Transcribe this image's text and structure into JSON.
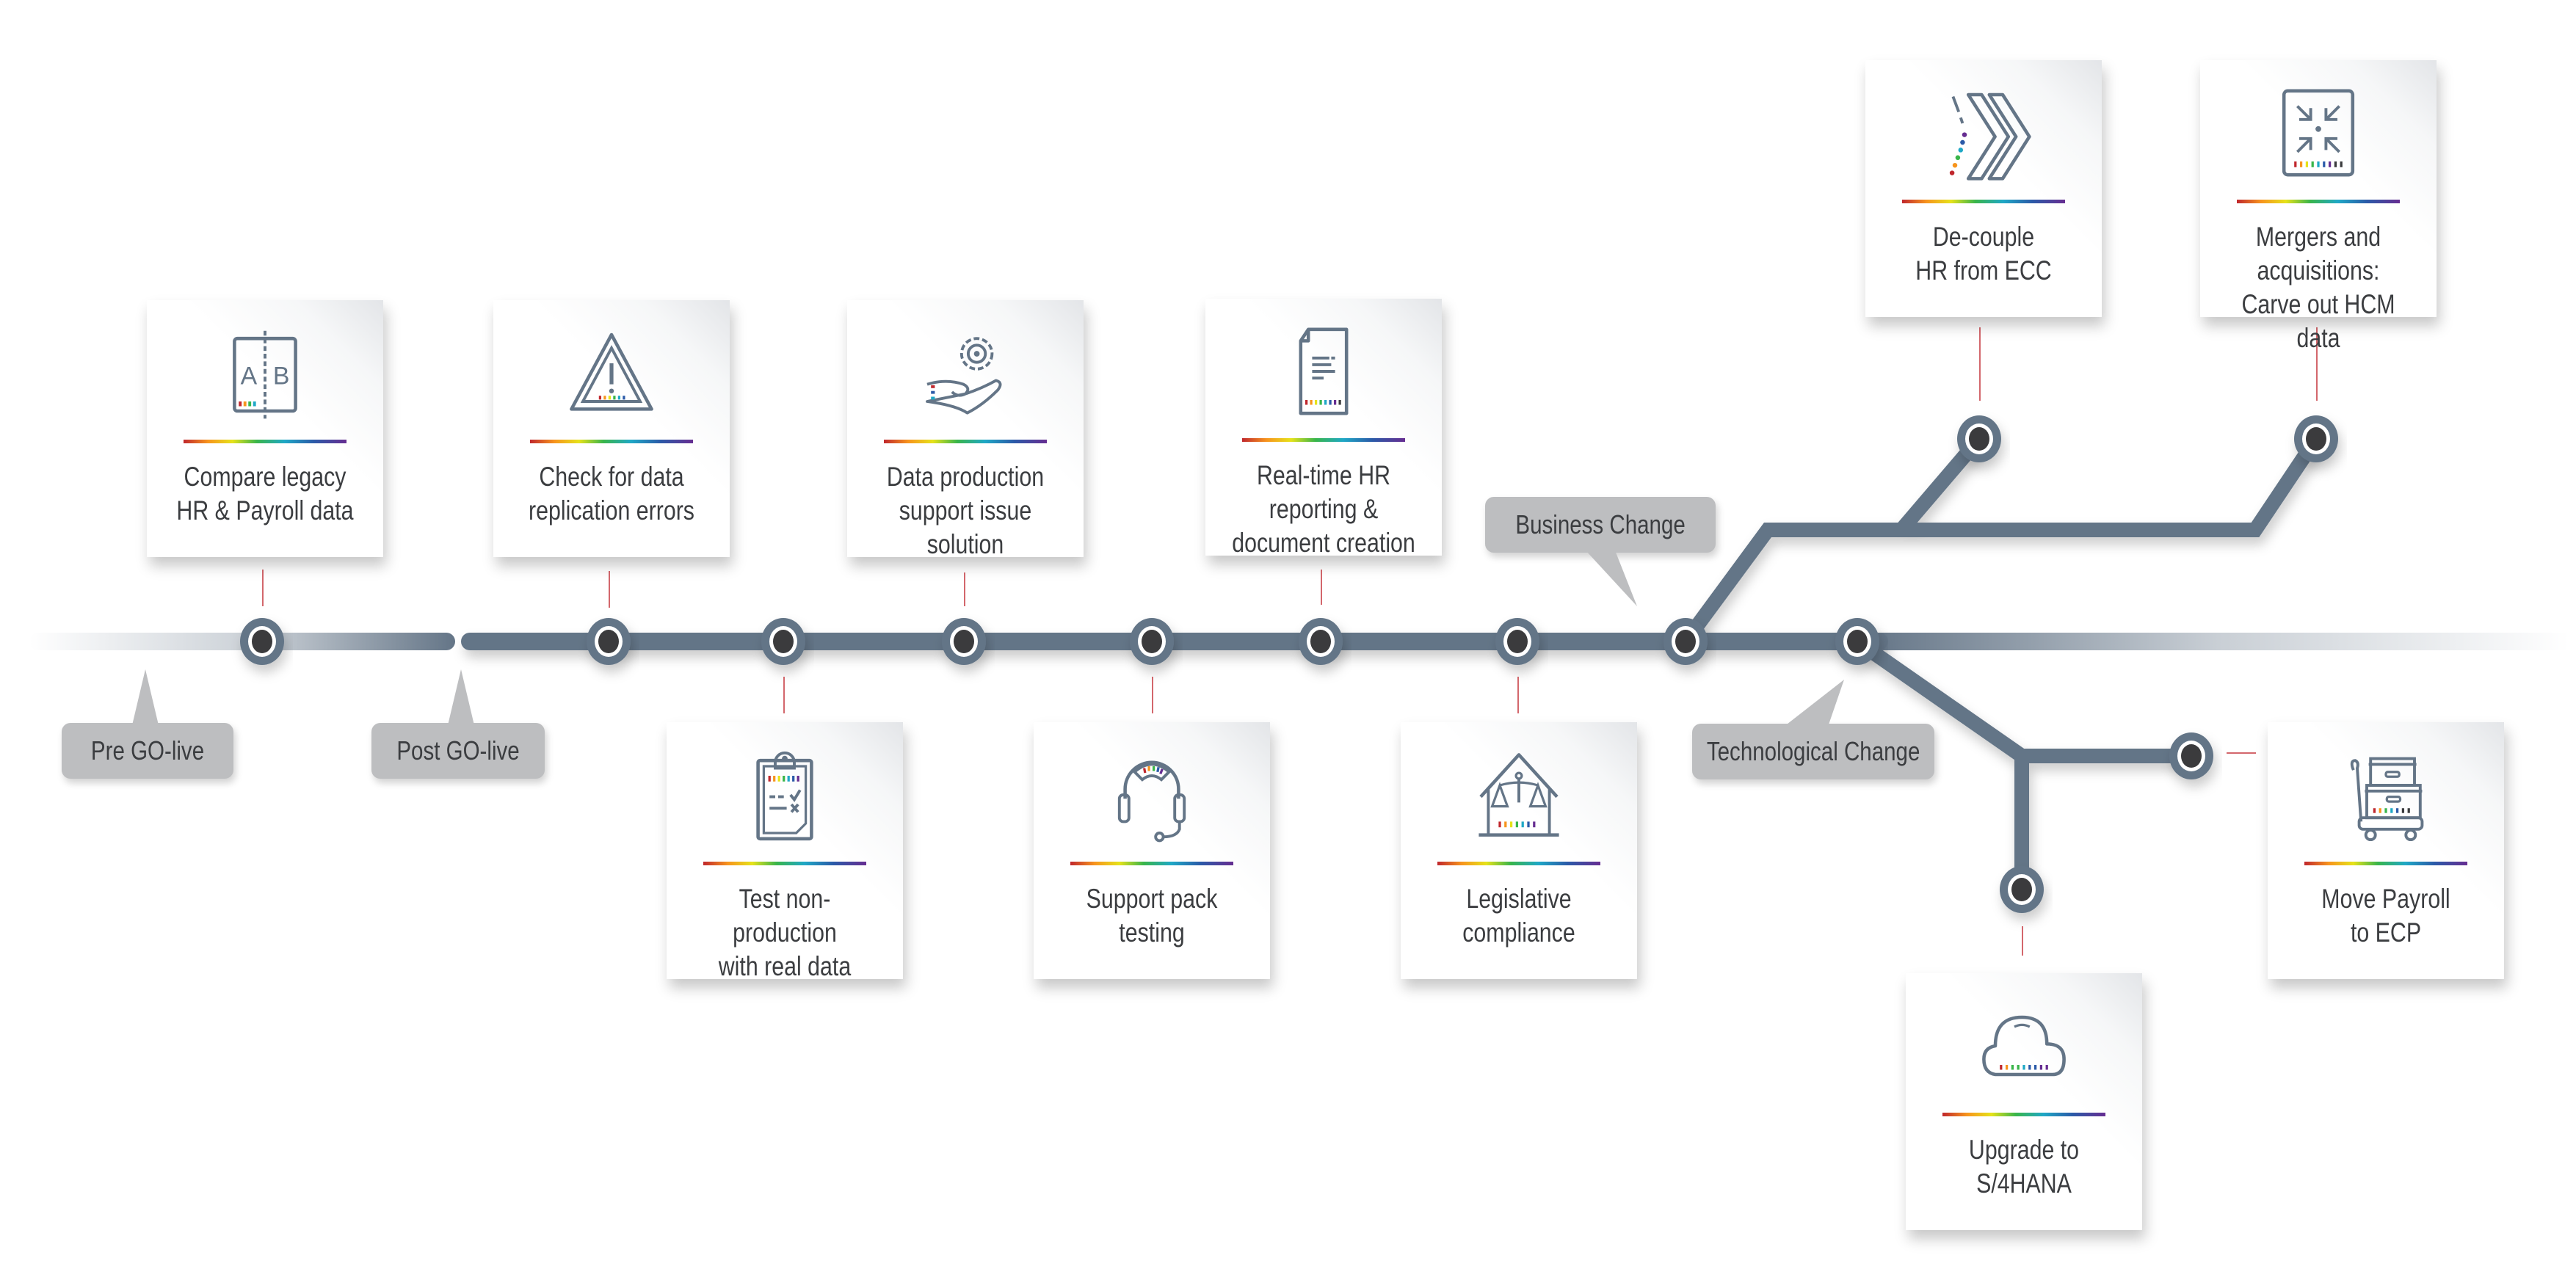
{
  "diagram": {
    "type": "metro-timeline",
    "colors": {
      "track": "#647587",
      "node_fill": "#3a3b3d",
      "tag_bg": "#bdbec0",
      "connector": "#c0272d",
      "text": "#3b3d40"
    },
    "phase_labels": [
      {
        "id": "pre",
        "label": "Pre GO-live"
      },
      {
        "id": "post",
        "label": "Post GO-live"
      }
    ],
    "branch_labels": [
      {
        "id": "business",
        "label": "Business Change"
      },
      {
        "id": "tech",
        "label": "Technological Change"
      }
    ],
    "cards": [
      {
        "id": "compare",
        "icon": "ab-compare-icon",
        "label": "Compare legacy\nHR & Payroll data"
      },
      {
        "id": "check",
        "icon": "warning-triangle-icon",
        "label": "Check for data\nreplication errors"
      },
      {
        "id": "dataprod",
        "icon": "gear-hand-icon",
        "label": "Data production\nsupport issue\nsolution"
      },
      {
        "id": "realtime",
        "icon": "document-icon",
        "label": "Real-time HR\nreporting &\ndocument creation"
      },
      {
        "id": "testnonprod",
        "icon": "clipboard-checklist-icon",
        "label": "Test non-production\nwith real data"
      },
      {
        "id": "supportpack",
        "icon": "headset-icon",
        "label": "Support pack\ntesting"
      },
      {
        "id": "legislative",
        "icon": "scales-house-icon",
        "label": "Legislative\ncompliance"
      },
      {
        "id": "decouple",
        "icon": "chevrons-right-icon",
        "label": "De-couple\nHR from ECC"
      },
      {
        "id": "mergers",
        "icon": "arrows-inward-icon",
        "label": "Mergers and\nacquisitions:\nCarve out HCM data"
      },
      {
        "id": "upgrade",
        "icon": "cloud-icon",
        "label": "Upgrade to\nS/4HANA"
      },
      {
        "id": "movepayroll",
        "icon": "cart-boxes-icon",
        "label": "Move Payroll\nto ECP"
      }
    ]
  }
}
